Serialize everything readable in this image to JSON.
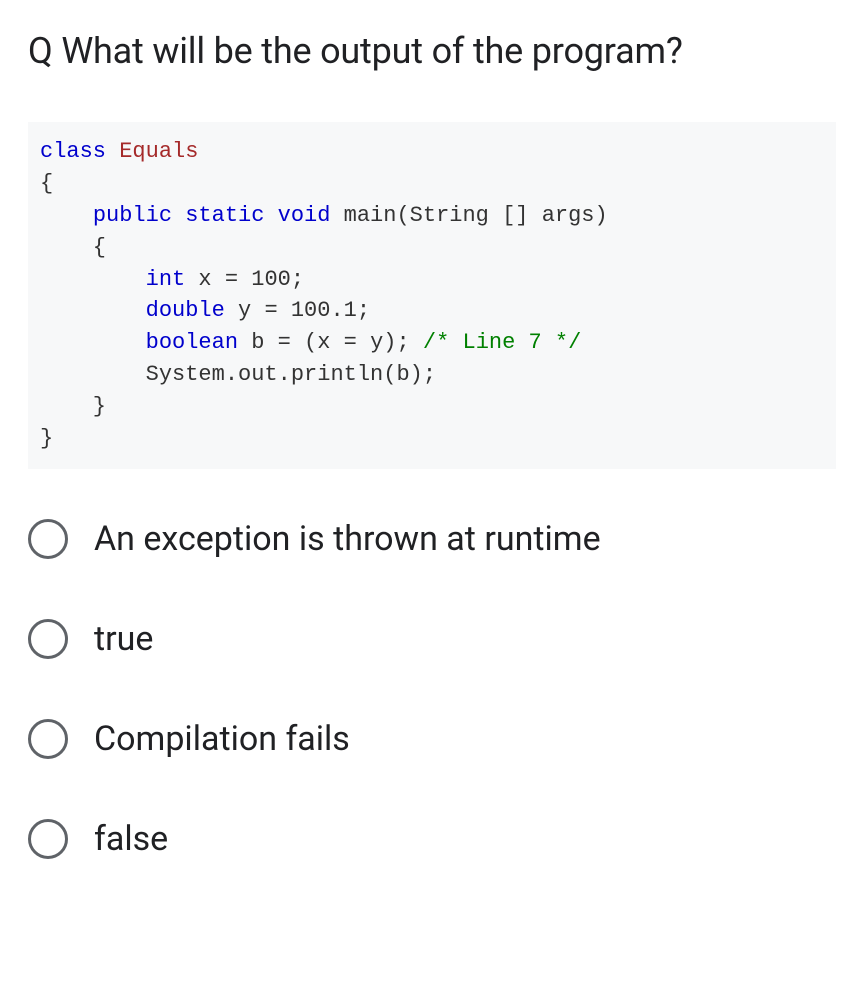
{
  "question": {
    "prefix": "Q",
    "text": "What will be the output of the program?"
  },
  "code": {
    "line1_kw": "class",
    "line1_name": "Equals",
    "line2": "{",
    "line3_mods": "public static void",
    "line3_sig": "main(String [] args)",
    "line4": "    {",
    "line5_type": "int",
    "line5_rest": " x = 100;",
    "line6_type": "double",
    "line6_rest": " y = 100.1;",
    "line7_type": "boolean",
    "line7_rest": " b = (x = y); ",
    "line7_comment": "/* Line 7 */",
    "line8": "        System.out.println(b);",
    "line9": "    }",
    "line10": "}"
  },
  "options": [
    {
      "label": "An exception is thrown at runtime"
    },
    {
      "label": "true"
    },
    {
      "label": "Compilation fails"
    },
    {
      "label": "false"
    }
  ]
}
